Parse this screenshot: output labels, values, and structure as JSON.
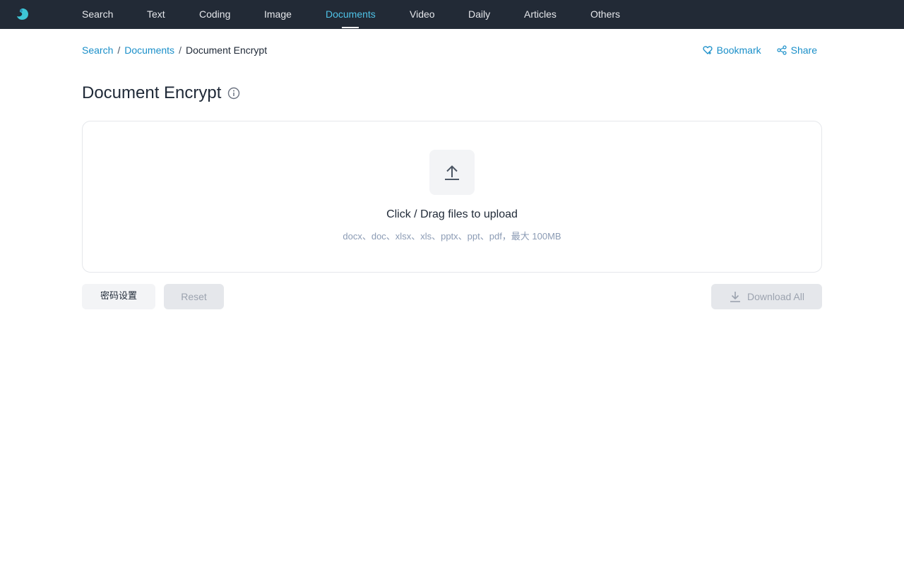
{
  "nav": {
    "items": [
      {
        "label": "Search"
      },
      {
        "label": "Text"
      },
      {
        "label": "Coding"
      },
      {
        "label": "Image"
      },
      {
        "label": "Documents",
        "active": true
      },
      {
        "label": "Video"
      },
      {
        "label": "Daily"
      },
      {
        "label": "Articles"
      },
      {
        "label": "Others"
      }
    ]
  },
  "breadcrumb": {
    "items": [
      "Search",
      "Documents"
    ],
    "separator": "/",
    "current": "Document Encrypt"
  },
  "actions": {
    "bookmark": "Bookmark",
    "share": "Share"
  },
  "page": {
    "title": "Document Encrypt"
  },
  "upload": {
    "main_text": "Click / Drag files to upload",
    "hint": "docx、doc、xlsx、xls、pptx、ppt、pdf，最大 100MB"
  },
  "buttons": {
    "password": "密码设置",
    "reset": "Reset",
    "download_all": "Download All"
  },
  "colors": {
    "nav_bg": "#222a36",
    "accent": "#4fc3e8",
    "link": "#1a8fc9"
  },
  "icons": {
    "logo": "brand-logo-icon",
    "info": "info-circle-icon",
    "upload": "upload-arrow-icon",
    "download": "download-arrow-icon",
    "bookmark": "heart-bookmark-icon",
    "share": "share-nodes-icon"
  }
}
